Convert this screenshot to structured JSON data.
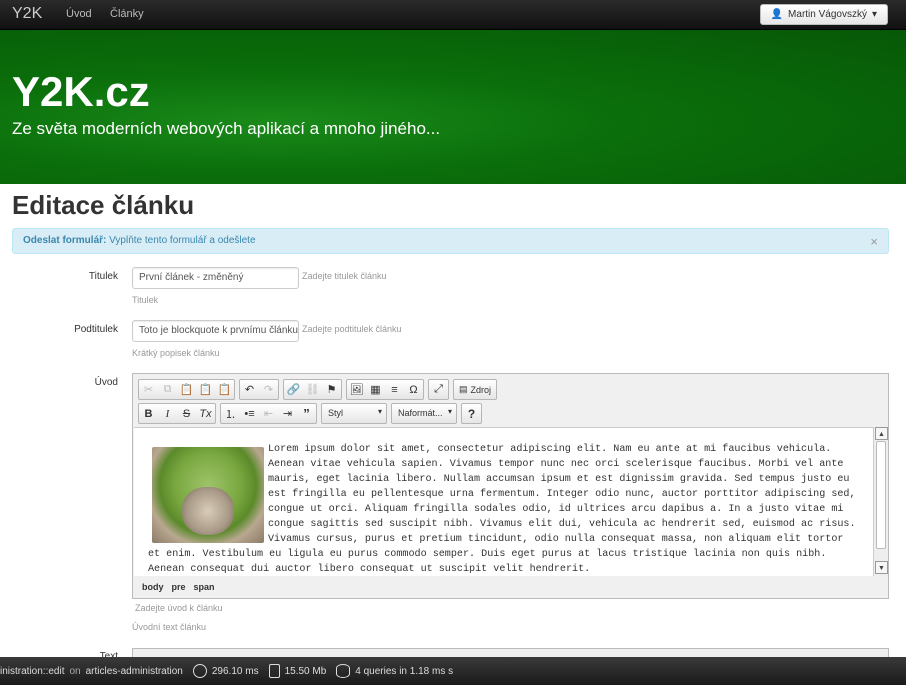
{
  "navbar": {
    "brand": "Y2K",
    "links": [
      "Úvod",
      "Články"
    ],
    "user": "Martin Vágovszký"
  },
  "hero": {
    "title": "Y2K.cz",
    "subtitle": "Ze světa moderních webových aplikací a mnoho jiného..."
  },
  "page": {
    "title": "Editace článku"
  },
  "alert": {
    "strong": "Odeslat formulář:",
    "text": " Vyplňte tento formulář a odešlete",
    "close": "×"
  },
  "form": {
    "title": {
      "label": "Titulek",
      "value": "První článek - změněný",
      "inline_hint": "Zadejte titulek článku",
      "help": "Titulek"
    },
    "subtitle": {
      "label": "Podtitulek",
      "value": "Toto je blockquote k prvnímu článku",
      "inline_hint": "Zadejte podtitulek článku",
      "help": "Krátký popisek článku"
    },
    "intro": {
      "label": "Úvod",
      "inline_hint": "Zadejte úvod k článku",
      "help": "Úvodní text článku"
    },
    "text": {
      "label": "Text"
    }
  },
  "editor": {
    "source_label": "Zdroj",
    "style_label": "Styl",
    "format_label": "Naformát...",
    "help_label": "?",
    "content": "Lorem ipsum dolor sit amet, consectetur adipiscing elit. Nam eu ante at mi faucibus vehicula. Aenean vitae vehicula sapien. Vivamus tempor nunc nec orci scelerisque faucibus. Morbi vel ante mauris, eget lacinia libero. Nullam accumsan ipsum et est dignissim gravida. Sed tempus justo eu est fringilla eu pellentesque urna fermentum. Integer odio nunc, auctor porttitor adipiscing sed, congue ut orci. Aliquam fringilla sodales odio, id ultrices arcu dapibus a. In a justo vitae mi congue sagittis sed suscipit nibh. Vivamus elit dui, vehicula ac hendrerit sed, euismod ac risus. Vivamus cursus, purus et pretium tincidunt, odio nulla consequat massa, non aliquam elit tortor et enim. Vestibulum eu ligula eu purus commodo semper. Duis eget purus at lacus tristique lacinia non quis nibh. Aenean consequat dui auctor libero consequat ut suscipit velit hendrerit.",
    "path": [
      "body",
      "pre",
      "span"
    ]
  },
  "debugbar": {
    "route": "inistration::edit",
    "on": "on",
    "presenter": "articles-administration",
    "time": "296.10 ms",
    "memory": "15.50 Mb",
    "queries": "4 queries in 1.18 ms s"
  }
}
